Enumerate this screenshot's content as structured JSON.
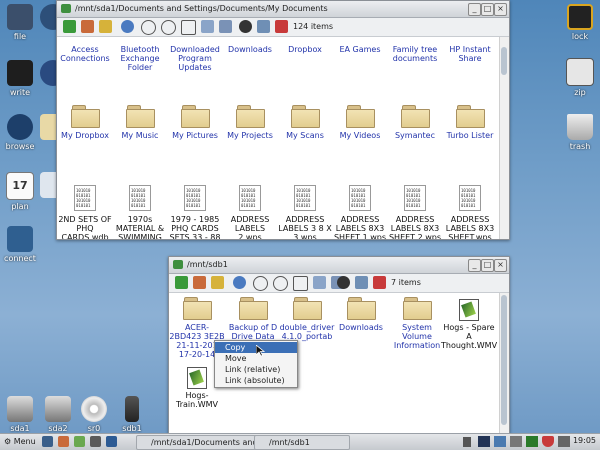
{
  "desktop": {
    "left_icons": [
      {
        "label": "file",
        "icon": "home-folder-icon"
      },
      {
        "label": "write",
        "icon": "write-icon"
      },
      {
        "label": "browse",
        "icon": "globe-icon"
      },
      {
        "label": "plan",
        "icon": "calendar-icon"
      },
      {
        "label": "connect",
        "icon": "network-icon"
      }
    ],
    "right_icons": [
      {
        "label": "lock",
        "icon": "padlock-icon"
      },
      {
        "label": "zip",
        "icon": "archive-icon"
      },
      {
        "label": "trash",
        "icon": "trash-icon"
      }
    ],
    "drive_icons": [
      {
        "label": "sda1",
        "icon": "hard-drive-icon"
      },
      {
        "label": "sda2",
        "icon": "hard-drive-icon"
      },
      {
        "label": "sr0",
        "icon": "optical-drive-icon"
      },
      {
        "label": "sdb1",
        "icon": "usb-drive-icon"
      }
    ]
  },
  "window1": {
    "title": "/mnt/sda1/Documents and Settings/Documents/My Documents",
    "item_count": "124 items",
    "row1": [
      "Access Connections",
      "Bluetooth Exchange Folder",
      "Downloaded Program Updates",
      "Downloads",
      "Dropbox",
      "EA Games",
      "Family tree documents",
      "HP Instant Share"
    ],
    "row2": [
      "My Dropbox",
      "My Music",
      "My Pictures",
      "My Projects",
      "My Scans",
      "My Videos",
      "Symantec",
      "Turbo Lister"
    ],
    "row3": [
      "2ND SETS OF PHQ CARDS.wdb",
      "1970s MATERIAL & SWIMMING",
      "1979 - 1985 PHQ CARDS SETS 33 - 88",
      "ADDRESS LABELS 2.wps",
      "ADDRESS LABELS 3 8 X 3.wps",
      "ADDRESS LABELS 8X3 SHEET 1.wps",
      "ADDRESS LABELS 8X3 SHEET 2.wps",
      "ADDRESS LABELS 8X3 SHEET.wps"
    ]
  },
  "window2": {
    "title": "/mnt/sdb1",
    "item_count": "7 items",
    "items": [
      "ACER-2BD423 3E2B 21-11-201 17-20-14",
      "Backup of D Drive Data",
      "double_driver 4.1.0_portab",
      "Downloads",
      "System Volume Information",
      "Hogs - Spare A Thought.WMV",
      "Hogs-Train.WMV"
    ]
  },
  "context_menu": [
    "Copy",
    "Move",
    "Link (relative)",
    "Link (absolute)"
  ],
  "taskbar": {
    "menu_label": "Menu",
    "task1": "/mnt/sda1/Documents and",
    "task2": "/mnt/sdb1",
    "clock": "19:05"
  },
  "colors": {
    "accent": "#3b6fb6",
    "desktop": "#5f8fc0",
    "file_text": "#2233aa"
  }
}
